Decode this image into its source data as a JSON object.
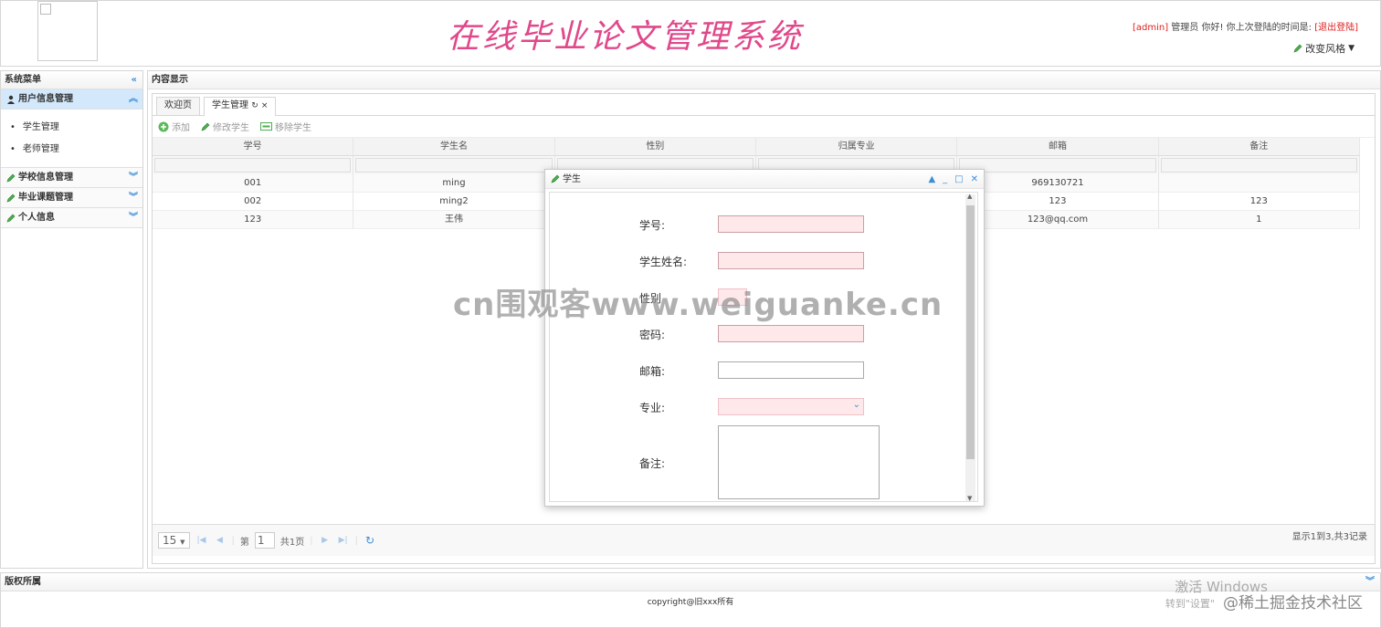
{
  "header": {
    "site_title": "在线毕业论文管理系统",
    "user_role": "[admin]",
    "user_greeting": " 管理员 你好! 你上次登陆的时间是: ",
    "logout": "[退出登陆]",
    "theme": "改变风格"
  },
  "sidebar": {
    "title": "系统菜单",
    "groups": [
      {
        "label": "用户信息管理",
        "items": [
          "学生管理",
          "老师管理"
        ]
      },
      {
        "label": "学校信息管理"
      },
      {
        "label": "毕业课题管理"
      },
      {
        "label": "个人信息"
      }
    ]
  },
  "content": {
    "title": "内容显示",
    "tabs": [
      "欢迎页",
      "学生管理"
    ],
    "toolbar": {
      "add": "添加",
      "edit": "修改学生",
      "remove": "移除学生"
    },
    "columns": [
      "学号",
      "学生名",
      "性别",
      "归属专业",
      "邮箱",
      "备注"
    ],
    "rows": [
      [
        "001",
        "ming",
        "",
        "",
        "969130721",
        ""
      ],
      [
        "002",
        "ming2",
        "",
        "",
        "123",
        "123"
      ],
      [
        "123",
        "王伟",
        "",
        "",
        "123@qq.com",
        "1"
      ]
    ]
  },
  "pager": {
    "page_size": "15",
    "page_label": "第",
    "page_value": "1",
    "total_pages": "共1页",
    "info": "显示1到3,共3记录"
  },
  "dialog": {
    "title": "学生",
    "fields": {
      "id": "学号:",
      "name": "学生姓名:",
      "gender": "性别",
      "password": "密码:",
      "email": "邮箱:",
      "major": "专业:",
      "remark": "备注:"
    }
  },
  "footer": {
    "title": "版权所属",
    "copyright": "copyright@旧xxx所有"
  },
  "overlay": {
    "watermark": "cn围观客www.weiguanke.cn",
    "win_activation": "激活 Windows",
    "win_activation_sub": "转到\"设置\"",
    "juejin": "@稀土掘金技术社区"
  },
  "colors": {
    "title_pink": "#e0488a",
    "accent_blue": "#3d8ed9",
    "invalid_bg": "#ffe8ea"
  }
}
